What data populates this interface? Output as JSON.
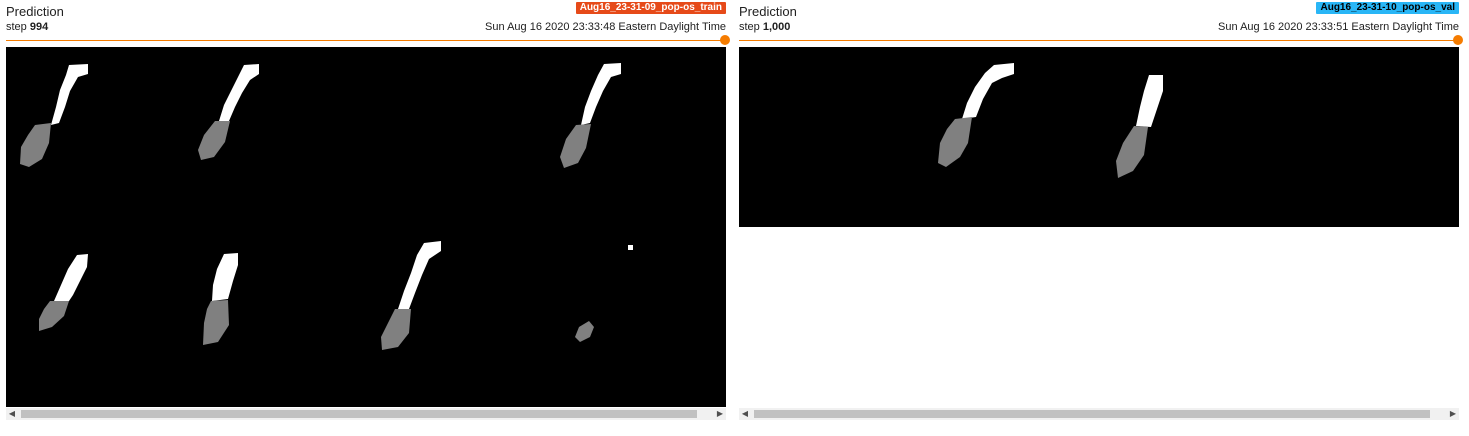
{
  "cards": [
    {
      "title": "Prediction",
      "run": "Aug16_23-31-09_pop-os_train",
      "run_color": "#e64a19",
      "run_text_color": "#ffffff",
      "step_label": "step",
      "step_value": "994",
      "timestamp": "Sun Aug 16 2020 23:33:48 Eastern Daylight Time"
    },
    {
      "title": "Prediction",
      "run": "Aug16_23-31-10_pop-os_val",
      "run_color": "#29b6f6",
      "run_text_color": "#000000",
      "step_label": "step",
      "step_value": "1,000",
      "timestamp": "Sun Aug 16 2020 23:33:51 Eastern Daylight Time"
    }
  ],
  "icons": {
    "scroll_left": "left-arrow-icon",
    "scroll_right": "right-arrow-icon"
  },
  "colors": {
    "slider": "#f57c00",
    "mask_white": "#ffffff",
    "mask_gray": "#808080",
    "image_background": "#000000"
  }
}
